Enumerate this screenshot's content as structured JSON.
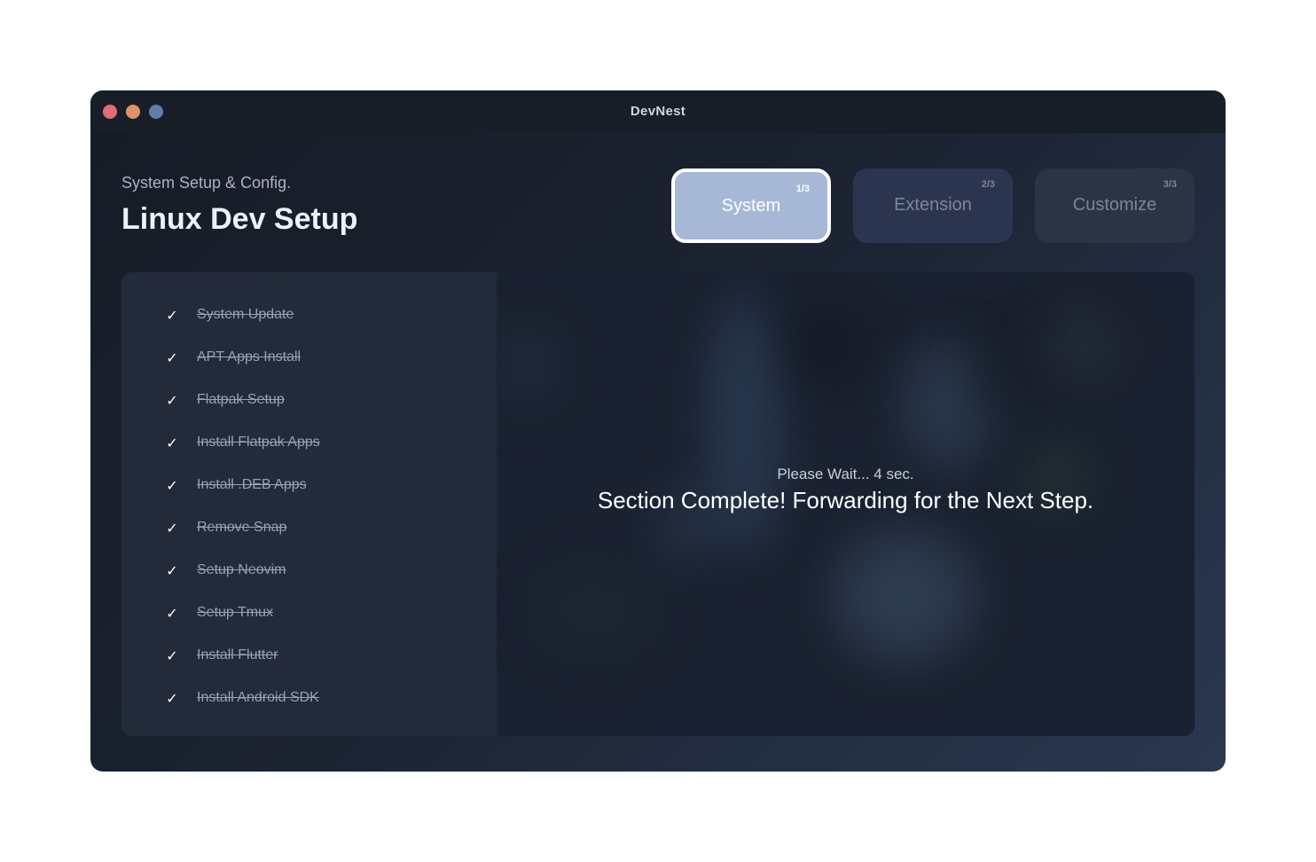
{
  "window": {
    "title": "DevNest",
    "controls": [
      "close",
      "minimize",
      "maximize"
    ]
  },
  "header": {
    "subtitle": "System Setup & Config.",
    "title": "Linux Dev Setup"
  },
  "steps": [
    {
      "label": "System",
      "count": "1/3",
      "state": "active"
    },
    {
      "label": "Extension",
      "count": "2/3",
      "state": "inactive"
    },
    {
      "label": "Customize",
      "count": "3/3",
      "state": "inactive"
    }
  ],
  "tasks": [
    {
      "label": "System Update",
      "done": true,
      "icon": "check-icon"
    },
    {
      "label": "APT Apps Install",
      "done": true,
      "icon": "check-icon"
    },
    {
      "label": "Flatpak Setup",
      "done": true,
      "icon": "check-icon"
    },
    {
      "label": "Install Flatpak Apps",
      "done": true,
      "icon": "check-icon"
    },
    {
      "label": "Install .DEB Apps",
      "done": true,
      "icon": "check-icon"
    },
    {
      "label": "Remove Snap",
      "done": true,
      "icon": "check-icon"
    },
    {
      "label": "Setup Neovim",
      "done": true,
      "icon": "check-icon"
    },
    {
      "label": "Setup Tmux",
      "done": true,
      "icon": "check-icon"
    },
    {
      "label": "Install Flutter",
      "done": true,
      "icon": "check-icon"
    },
    {
      "label": "Install Android SDK",
      "done": true,
      "icon": "check-icon"
    }
  ],
  "status": {
    "wait_text": "Please Wait... 4 sec.",
    "message": "Section Complete! Forwarding for the Next Step."
  },
  "colors": {
    "window_bg": "#1b2230",
    "titlebar": "#181e28",
    "active_step": "#a6b8d6",
    "close": "#e06c75",
    "minimize": "#e0916a",
    "maximize": "#5f7fa8"
  }
}
